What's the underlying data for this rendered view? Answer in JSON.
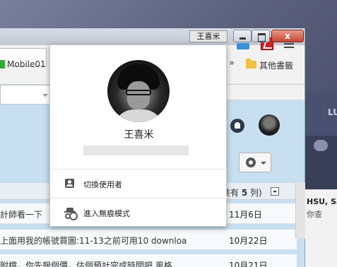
{
  "window": {
    "title_name": "王喜米",
    "close_label": "x"
  },
  "bookmarks": {
    "mobile": "Mobile01",
    "more": "»",
    "other": "其他書籤"
  },
  "popup": {
    "user_name": "王喜米",
    "switch_user": "切換使用者",
    "incognito": "進入無痕模式"
  },
  "mail": {
    "count_prefix": "共有",
    "count_value": "5",
    "count_suffix": "列)",
    "rows": [
      {
        "subject": "計師看一下",
        "date": "11月6日"
      },
      {
        "subject": "上面用我的帳號買圖:11-13之前可用10 downloa",
        "date": "10月22日"
      },
      {
        "subject": "附檔，你先報個價，估個預計完成時間吧 風格",
        "date": "10月21日"
      }
    ]
  },
  "side_app": {
    "header_text": "LU",
    "row_name": "HSU, Sa",
    "row_sub": "你查"
  }
}
